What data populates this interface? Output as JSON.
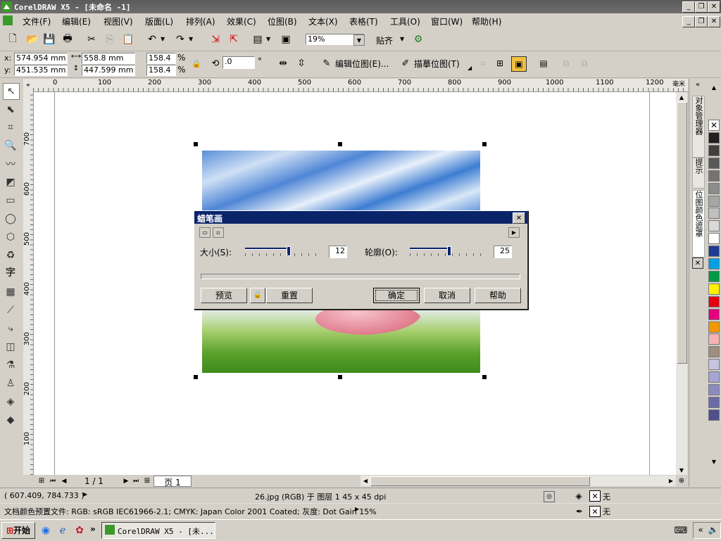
{
  "title_bar": {
    "title": "CorelDRAW X5 - [未命名 -1]"
  },
  "menu": {
    "items": [
      "文件(F)",
      "编辑(E)",
      "视图(V)",
      "版面(L)",
      "排列(A)",
      "效果(C)",
      "位图(B)",
      "文本(X)",
      "表格(T)",
      "工具(O)",
      "窗口(W)",
      "帮助(H)"
    ]
  },
  "toolbar": {
    "zoom": "19%",
    "snap_label": "贴齐"
  },
  "property_bar": {
    "x": "574.954 mm",
    "y": "451.535 mm",
    "width": "558.8 mm",
    "height": "447.599 mm",
    "scale_x": "158.4",
    "scale_y": "158.4",
    "percent": "%",
    "rotation": ".0",
    "degree": "°",
    "edit_bitmap": "编辑位图(E)...",
    "trace_bitmap": "描摹位图(T)"
  },
  "ruler": {
    "unit": "毫米",
    "h_ticks": [
      "0",
      "100",
      "200",
      "300",
      "400",
      "500",
      "600",
      "700",
      "800",
      "900",
      "1000",
      "1100",
      "1200"
    ],
    "v_ticks": [
      "700",
      "600",
      "500",
      "400",
      "300",
      "200",
      "100"
    ]
  },
  "dialog": {
    "title": "蜡笔画",
    "size_label": "大小(S):",
    "size_value": "12",
    "size_level": 0.55,
    "outline_label": "轮廓(O):",
    "outline_value": "25",
    "outline_level": 0.5,
    "preview": "预览",
    "reset": "重置",
    "ok": "确定",
    "cancel": "取消",
    "help": "帮助"
  },
  "page_nav": {
    "counter": "1 / 1",
    "page_tab": "页 1"
  },
  "docker": {
    "tab1": "对象管理器",
    "tab2": "提示",
    "tab3": "位图颜色遮罩"
  },
  "palette": {
    "colors": [
      "#231f20",
      "#404040",
      "#595959",
      "#737373",
      "#8c8c8c",
      "#a6a6a6",
      "#c0c0c0",
      "#d9d9d9",
      "#ffffff",
      "#1f3a93",
      "#00a0e3",
      "#009944",
      "#fff000",
      "#e60012",
      "#e4007f",
      "#f39800",
      "#f5b2b2",
      "#9e8f7f",
      "#c7c3e0",
      "#a6a6d2",
      "#8b8bc2",
      "#6b6ba8",
      "#4f4f8f"
    ]
  },
  "status": {
    "coords": "( 607.409, 784.733 )",
    "object_info": "26.jpg (RGB) 于 图层 1 45 x 45 dpi",
    "fill_label": "无",
    "outline_label": "无",
    "color_profile": "文档颜色预置文件: RGB: sRGB IEC61966-2.1; CMYK: Japan Color 2001 Coated; 灰度: Dot Gain 15%"
  },
  "taskbar": {
    "start": "开始",
    "task": "CorelDRAW X5 - [未..."
  }
}
